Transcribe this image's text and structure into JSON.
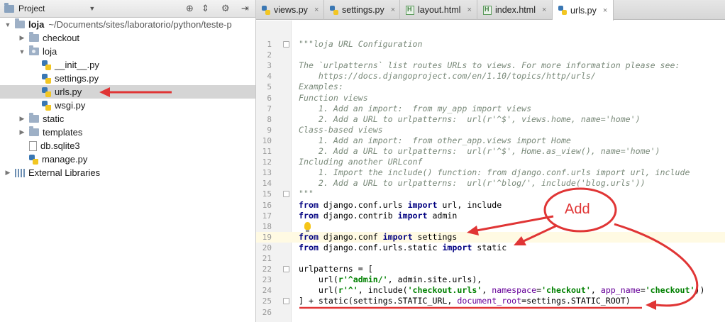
{
  "project_panel": {
    "title": "Project",
    "dropdown_icon": "chevron-down-icon",
    "header_icons": [
      "target-icon",
      "collapse-icon",
      "gear-icon",
      "hide-icon"
    ],
    "tree": [
      {
        "label": "loja",
        "path": "~/Documents/sites/laboratorio/python/teste-p",
        "arrow": "▼",
        "icon": "folder",
        "bold": true,
        "indent": 0
      },
      {
        "label": "checkout",
        "arrow": "▶",
        "icon": "folder",
        "indent": 1
      },
      {
        "label": "loja",
        "arrow": "▼",
        "icon": "folder",
        "indent": 1
      },
      {
        "label": "__init__.py",
        "icon": "py",
        "indent": 2
      },
      {
        "label": "settings.py",
        "icon": "py",
        "indent": 2
      },
      {
        "label": "urls.py",
        "icon": "py",
        "indent": 2,
        "selected": true
      },
      {
        "label": "wsgi.py",
        "icon": "py",
        "indent": 2
      },
      {
        "label": "static",
        "arrow": "▶",
        "icon": "folder",
        "indent": 1
      },
      {
        "label": "templates",
        "arrow": "▶",
        "icon": "folder",
        "indent": 1
      },
      {
        "label": "db.sqlite3",
        "icon": "file",
        "indent": 1
      },
      {
        "label": "manage.py",
        "icon": "py",
        "indent": 1
      },
      {
        "label": "External Libraries",
        "arrow": "▶",
        "icon": "libs",
        "indent": 0
      }
    ]
  },
  "tabs": [
    {
      "label": "views.py",
      "icon": "py",
      "close": "×"
    },
    {
      "label": "settings.py",
      "icon": "py",
      "close": "×"
    },
    {
      "label": "layout.html",
      "icon": "html",
      "close": "×"
    },
    {
      "label": "index.html",
      "icon": "html",
      "close": "×"
    },
    {
      "label": "urls.py",
      "icon": "py",
      "close": "×",
      "active": true
    }
  ],
  "editor": {
    "highlighted_line": 19,
    "lines": [
      {
        "n": "1",
        "parts": [
          {
            "t": "\"\"\"",
            "c": "doc"
          },
          {
            "t": "loja URL Configuration",
            "c": "doc"
          }
        ]
      },
      {
        "n": "2",
        "parts": []
      },
      {
        "n": "3",
        "parts": [
          {
            "t": "The `urlpatterns` list routes URLs to views. For more information please see:",
            "c": "doc"
          }
        ]
      },
      {
        "n": "4",
        "parts": [
          {
            "t": "    https://docs.djangoproject.com/en/1.10/topics/http/urls/",
            "c": "doc"
          }
        ]
      },
      {
        "n": "5",
        "parts": [
          {
            "t": "Examples:",
            "c": "doc"
          }
        ]
      },
      {
        "n": "6",
        "parts": [
          {
            "t": "Function views",
            "c": "doc"
          }
        ]
      },
      {
        "n": "7",
        "parts": [
          {
            "t": "    1. Add an import:  from my_app import views",
            "c": "doc"
          }
        ]
      },
      {
        "n": "8",
        "parts": [
          {
            "t": "    2. Add a URL to urlpatterns:  url(r'^$', views.home, name='home')",
            "c": "doc"
          }
        ]
      },
      {
        "n": "9",
        "parts": [
          {
            "t": "Class-based views",
            "c": "doc"
          }
        ]
      },
      {
        "n": "10",
        "parts": [
          {
            "t": "    1. Add an import:  from other_app.views import Home",
            "c": "doc"
          }
        ]
      },
      {
        "n": "11",
        "parts": [
          {
            "t": "    2. Add a URL to urlpatterns:  url(r'^$', Home.as_view(), name='home')",
            "c": "doc"
          }
        ]
      },
      {
        "n": "12",
        "parts": [
          {
            "t": "Including another URLconf",
            "c": "doc"
          }
        ]
      },
      {
        "n": "13",
        "parts": [
          {
            "t": "    1. Import the include() function: from django.conf.urls import url, include",
            "c": "doc"
          }
        ]
      },
      {
        "n": "14",
        "parts": [
          {
            "t": "    2. Add a URL to urlpatterns:  url(r'^blog/', include('blog.urls'))",
            "c": "doc"
          }
        ]
      },
      {
        "n": "15",
        "parts": [
          {
            "t": "\"\"\"",
            "c": "doc"
          }
        ]
      },
      {
        "n": "16",
        "parts": [
          {
            "t": "from",
            "c": "kw"
          },
          {
            "t": " django.conf.urls ",
            "c": ""
          },
          {
            "t": "import",
            "c": "kw"
          },
          {
            "t": " url, include",
            "c": ""
          }
        ]
      },
      {
        "n": "17",
        "parts": [
          {
            "t": "from",
            "c": "kw"
          },
          {
            "t": " django.contrib ",
            "c": ""
          },
          {
            "t": "import",
            "c": "kw"
          },
          {
            "t": " admin",
            "c": ""
          }
        ]
      },
      {
        "n": "18",
        "parts": []
      },
      {
        "n": "19",
        "parts": [
          {
            "t": "from",
            "c": "kw"
          },
          {
            "t": " django.conf ",
            "c": ""
          },
          {
            "t": "import",
            "c": "kw"
          },
          {
            "t": " settings",
            "c": ""
          }
        ]
      },
      {
        "n": "20",
        "parts": [
          {
            "t": "from",
            "c": "kw"
          },
          {
            "t": " django.conf.urls.static ",
            "c": ""
          },
          {
            "t": "import",
            "c": "kw"
          },
          {
            "t": " static",
            "c": ""
          }
        ]
      },
      {
        "n": "21",
        "parts": []
      },
      {
        "n": "22",
        "parts": [
          {
            "t": "urlpatterns = [",
            "c": ""
          }
        ]
      },
      {
        "n": "23",
        "parts": [
          {
            "t": "    url(",
            "c": ""
          },
          {
            "t": "r'^admin/'",
            "c": "str"
          },
          {
            "t": ", admin.site.urls),",
            "c": ""
          }
        ]
      },
      {
        "n": "24",
        "parts": [
          {
            "t": "    url(",
            "c": ""
          },
          {
            "t": "r'^'",
            "c": "str"
          },
          {
            "t": ", include(",
            "c": ""
          },
          {
            "t": "'checkout.urls'",
            "c": "str"
          },
          {
            "t": ", ",
            "c": ""
          },
          {
            "t": "namespace",
            "c": "param"
          },
          {
            "t": "=",
            "c": ""
          },
          {
            "t": "'checkout'",
            "c": "str"
          },
          {
            "t": ", ",
            "c": ""
          },
          {
            "t": "app_name",
            "c": "param"
          },
          {
            "t": "=",
            "c": ""
          },
          {
            "t": "'checkout'",
            "c": "str"
          },
          {
            "t": "))",
            "c": ""
          }
        ]
      },
      {
        "n": "25",
        "parts": [
          {
            "t": "] + static(settings.STATIC_URL, ",
            "c": ""
          },
          {
            "t": "document_root",
            "c": "param"
          },
          {
            "t": "=settings.STATIC_ROOT)",
            "c": ""
          }
        ]
      },
      {
        "n": "26",
        "parts": []
      }
    ]
  },
  "annotation": {
    "label": "Add",
    "color": "#e03535"
  }
}
